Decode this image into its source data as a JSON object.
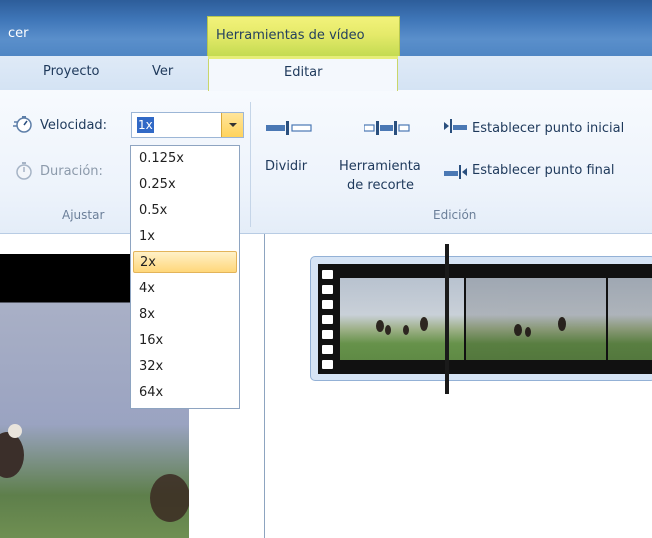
{
  "window": {
    "app_title_fragment": "cer"
  },
  "contextual_tab_group": {
    "label": "Herramientas de vídeo"
  },
  "tabs": [
    {
      "label": "Proyecto"
    },
    {
      "label": "Ver"
    },
    {
      "label": "Editar"
    }
  ],
  "ribbon": {
    "ajustar": {
      "group_label": "Ajustar",
      "speed_label": "Velocidad:",
      "speed_value": "1x",
      "duration_label": "Duración:"
    },
    "edicion": {
      "group_label": "Edición",
      "split_label": "Dividir",
      "trim_label_line1": "Herramienta",
      "trim_label_line2": "de recorte",
      "set_start_label": "Establecer punto inicial",
      "set_end_label": "Establecer punto final"
    }
  },
  "speed_dropdown": {
    "options": [
      "0.125x",
      "0.25x",
      "0.5x",
      "1x",
      "2x",
      "4x",
      "8x",
      "16x",
      "32x",
      "64x"
    ],
    "highlighted": "2x"
  },
  "colors": {
    "titlebar": "#3f76b8",
    "contextual_tab": "#e5ea6a",
    "selection": "#3169c6",
    "highlight": "#ffd77a"
  }
}
